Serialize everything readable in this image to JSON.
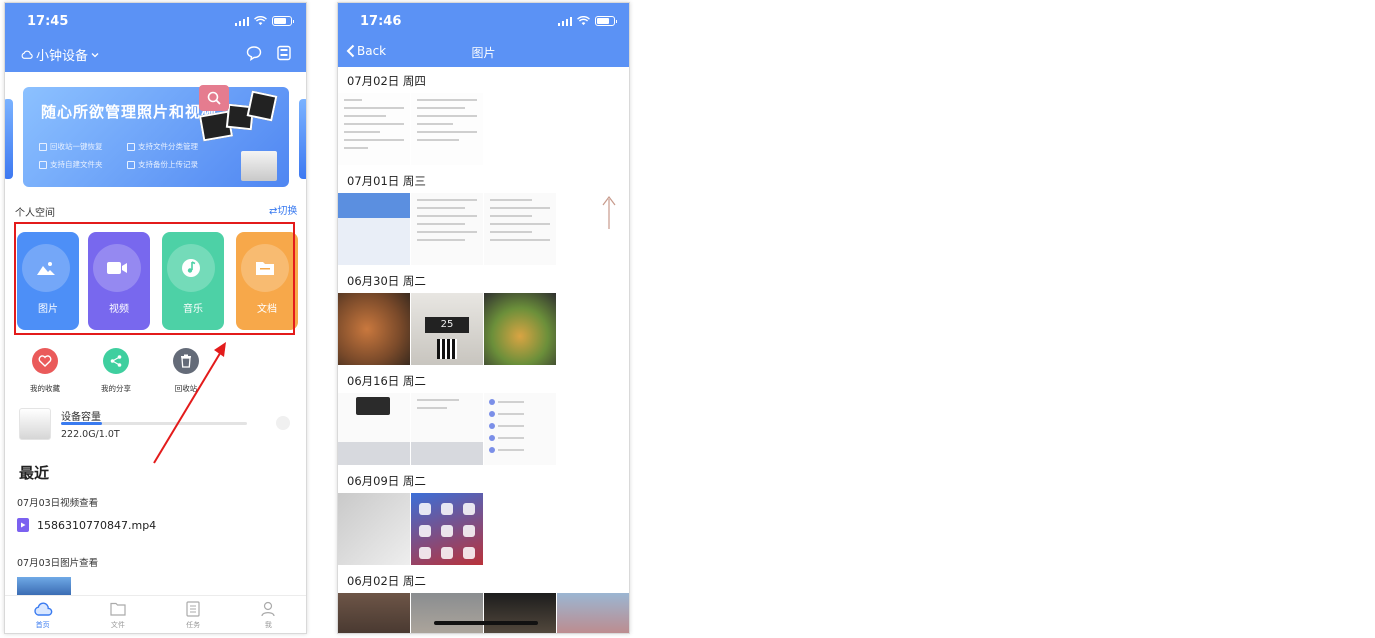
{
  "phone1": {
    "status": {
      "time": "17:45"
    },
    "header": {
      "device_name": "小钟设备"
    },
    "banner": {
      "title": "随心所欲管理照片和视频",
      "features": [
        "回收站一键恢复",
        "支持文件分类管理",
        "支持自建文件夹",
        "支持备份上传记录"
      ]
    },
    "personal_space": {
      "label": "个人空间",
      "switch_label": "⇄切换"
    },
    "categories": [
      {
        "label": "图片",
        "color": "#4d8ff7"
      },
      {
        "label": "视频",
        "color": "#7868ee"
      },
      {
        "label": "音乐",
        "color": "#4dd1a6"
      },
      {
        "label": "文档",
        "color": "#f7a84a"
      }
    ],
    "quick_actions": [
      {
        "label": "我的收藏",
        "color": "#ea5a5a"
      },
      {
        "label": "我的分享",
        "color": "#3fcf9f"
      },
      {
        "label": "回收站",
        "color": "#646b78"
      }
    ],
    "storage": {
      "title": "设备容量",
      "value": "222.0G/1.0T",
      "used_fraction": 0.22
    },
    "recent": {
      "title": "最近",
      "groups": [
        {
          "date": "07月03日视频查看",
          "file": "1586310770847.mp4"
        },
        {
          "date": "07月03日图片查看"
        }
      ]
    },
    "tabs": [
      {
        "label": "首页",
        "active": true
      },
      {
        "label": "文件",
        "active": false
      },
      {
        "label": "任务",
        "active": false
      },
      {
        "label": "我",
        "active": false
      }
    ]
  },
  "phone2": {
    "status": {
      "time": "17:46"
    },
    "header": {
      "back_label": "Back",
      "title": "图片"
    },
    "groups": [
      {
        "date": "07月02日 周四"
      },
      {
        "date": "07月01日 周三"
      },
      {
        "date": "06月30日 周二",
        "photo_label": "25"
      },
      {
        "date": "06月16日 周二"
      },
      {
        "date": "06月09日 周二"
      },
      {
        "date": "06月02日 周二"
      }
    ]
  },
  "colors": {
    "accent": "#5b92f5",
    "highlight": "#e31b1b"
  }
}
